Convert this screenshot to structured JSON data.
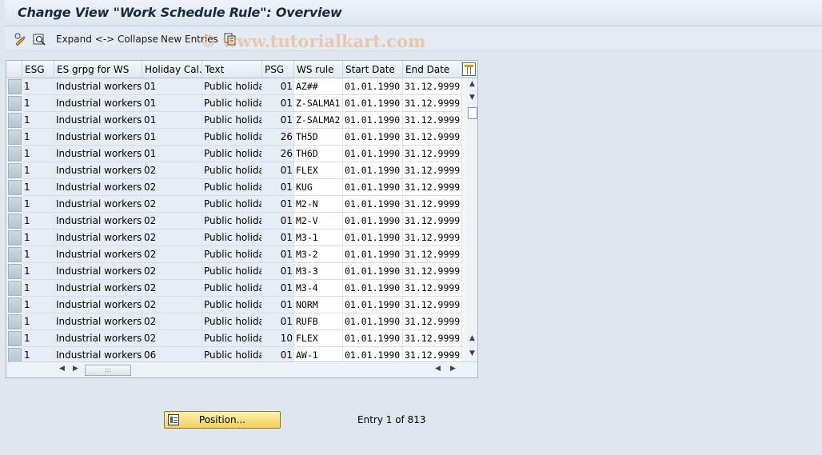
{
  "window": {
    "title": "Change View \"Work Schedule Rule\": Overview"
  },
  "toolbar": {
    "expand_collapse_label": "Expand <-> Collapse",
    "new_entries_label": "New Entries",
    "watermark": "© www.tutorialkart.com"
  },
  "table": {
    "columns": [
      "ESG",
      "ES grpg for WS",
      "Holiday Cal...",
      "Text",
      "PSG",
      "WS rule",
      "Start Date",
      "End Date"
    ],
    "rows": [
      [
        "1",
        "Industrial workers",
        "01",
        "Public holida...",
        "01",
        "AZ##",
        "01.01.1990",
        "31.12.9999"
      ],
      [
        "1",
        "Industrial workers",
        "01",
        "Public holida...",
        "01",
        "Z-SALMA1",
        "01.01.1990",
        "31.12.9999"
      ],
      [
        "1",
        "Industrial workers",
        "01",
        "Public holida...",
        "01",
        "Z-SALMA2",
        "01.01.1990",
        "31.12.9999"
      ],
      [
        "1",
        "Industrial workers",
        "01",
        "Public holida...",
        "26",
        "TH5D",
        "01.01.1990",
        "31.12.9999"
      ],
      [
        "1",
        "Industrial workers",
        "01",
        "Public holida...",
        "26",
        "TH6D",
        "01.01.1990",
        "31.12.9999"
      ],
      [
        "1",
        "Industrial workers",
        "02",
        "Public holida...",
        "01",
        "FLEX",
        "01.01.1990",
        "31.12.9999"
      ],
      [
        "1",
        "Industrial workers",
        "02",
        "Public holida...",
        "01",
        "KUG",
        "01.01.1990",
        "31.12.9999"
      ],
      [
        "1",
        "Industrial workers",
        "02",
        "Public holida...",
        "01",
        "M2-N",
        "01.01.1990",
        "31.12.9999"
      ],
      [
        "1",
        "Industrial workers",
        "02",
        "Public holida...",
        "01",
        "M2-V",
        "01.01.1990",
        "31.12.9999"
      ],
      [
        "1",
        "Industrial workers",
        "02",
        "Public holida...",
        "01",
        "M3-1",
        "01.01.1990",
        "31.12.9999"
      ],
      [
        "1",
        "Industrial workers",
        "02",
        "Public holida...",
        "01",
        "M3-2",
        "01.01.1990",
        "31.12.9999"
      ],
      [
        "1",
        "Industrial workers",
        "02",
        "Public holida...",
        "01",
        "M3-3",
        "01.01.1990",
        "31.12.9999"
      ],
      [
        "1",
        "Industrial workers",
        "02",
        "Public holida...",
        "01",
        "M3-4",
        "01.01.1990",
        "31.12.9999"
      ],
      [
        "1",
        "Industrial workers",
        "02",
        "Public holida...",
        "01",
        "NORM",
        "01.01.1990",
        "31.12.9999"
      ],
      [
        "1",
        "Industrial workers",
        "02",
        "Public holida...",
        "01",
        "RUFB",
        "01.01.1990",
        "31.12.9999"
      ],
      [
        "1",
        "Industrial workers",
        "02",
        "Public holida...",
        "10",
        "FLEX",
        "01.01.1990",
        "31.12.9999"
      ],
      [
        "1",
        "Industrial workers",
        "06",
        "Public holida...",
        "01",
        "AW-1",
        "01.01.1990",
        "31.12.9999"
      ]
    ],
    "horizontal_scroll_thumb": ":::"
  },
  "footer": {
    "position_button_label": "Position...",
    "entry_text": "Entry 1 of 813"
  }
}
